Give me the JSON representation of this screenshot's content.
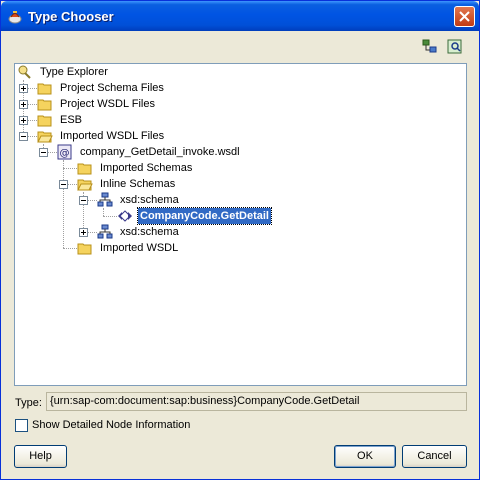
{
  "window": {
    "title": "Type Chooser"
  },
  "tree": {
    "items": [
      {
        "label": "Type Explorer"
      },
      {
        "label": "Project Schema Files"
      },
      {
        "label": "Project WSDL Files"
      },
      {
        "label": "ESB"
      },
      {
        "label": "Imported WSDL Files"
      },
      {
        "label": "company_GetDetail_invoke.wsdl"
      },
      {
        "label": "Imported Schemas"
      },
      {
        "label": "Inline Schemas"
      },
      {
        "label": "xsd:schema"
      },
      {
        "label": "CompanyCode.GetDetail"
      },
      {
        "label": "xsd:schema"
      },
      {
        "label": "Imported WSDL"
      }
    ]
  },
  "type_field": {
    "label": "Type:",
    "value": "{urn:sap-com:document:sap:business}CompanyCode.GetDetail"
  },
  "checkbox": {
    "label": "Show Detailed Node Information",
    "checked": false
  },
  "buttons": {
    "help": "Help",
    "ok": "OK",
    "cancel": "Cancel"
  },
  "colors": {
    "selection": "#316ac5",
    "titlebar": "#0054e3",
    "dialog": "#ece9d8"
  }
}
